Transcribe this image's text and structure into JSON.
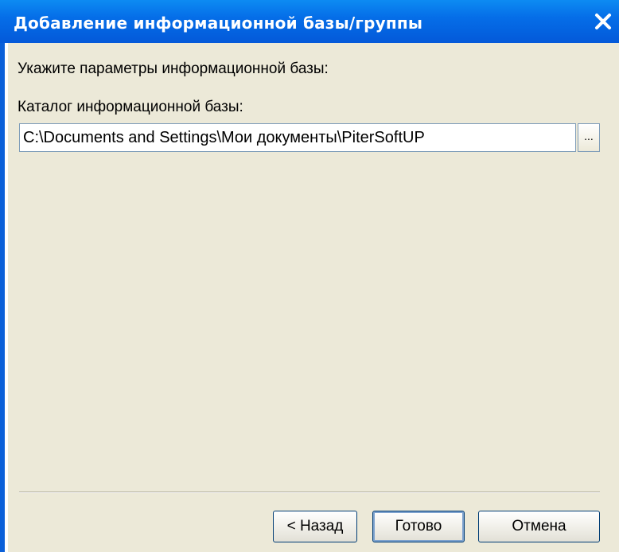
{
  "window": {
    "title": "Добавление информационной базы/группы",
    "close_glyph": "✕"
  },
  "main": {
    "prompt": "Укажите параметры информационной базы:",
    "catalog_label": "Каталог информационной базы:",
    "catalog_value": "C:\\Documents and Settings\\Мои документы\\PiterSoftUP",
    "browse_label": "..."
  },
  "footer": {
    "back_label": "< Назад",
    "done_label": "Готово",
    "cancel_label": "Отмена"
  },
  "colors": {
    "titlebar": "#0459d9",
    "client_bg": "#ece9d8",
    "button_border": "#003c74"
  }
}
